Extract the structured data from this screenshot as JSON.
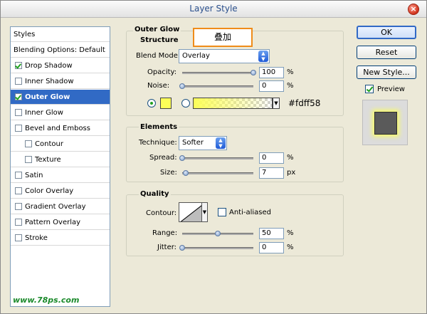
{
  "window": {
    "title": "Layer Style",
    "close_glyph": "×"
  },
  "callout_text": "叠加",
  "left_pane": {
    "items": [
      {
        "label": "Styles",
        "checkbox": false,
        "checked": false,
        "selected": false,
        "sub": false
      },
      {
        "label": "Blending Options: Default",
        "checkbox": false,
        "checked": false,
        "selected": false,
        "sub": false
      },
      {
        "label": "Drop Shadow",
        "checkbox": true,
        "checked": true,
        "selected": false,
        "sub": false
      },
      {
        "label": "Inner Shadow",
        "checkbox": true,
        "checked": false,
        "selected": false,
        "sub": false
      },
      {
        "label": "Outer Glow",
        "checkbox": true,
        "checked": true,
        "selected": true,
        "sub": false
      },
      {
        "label": "Inner Glow",
        "checkbox": true,
        "checked": false,
        "selected": false,
        "sub": false
      },
      {
        "label": "Bevel and Emboss",
        "checkbox": true,
        "checked": false,
        "selected": false,
        "sub": false
      },
      {
        "label": "Contour",
        "checkbox": true,
        "checked": false,
        "selected": false,
        "sub": true
      },
      {
        "label": "Texture",
        "checkbox": true,
        "checked": false,
        "selected": false,
        "sub": true
      },
      {
        "label": "Satin",
        "checkbox": true,
        "checked": false,
        "selected": false,
        "sub": false
      },
      {
        "label": "Color Overlay",
        "checkbox": true,
        "checked": false,
        "selected": false,
        "sub": false
      },
      {
        "label": "Gradient Overlay",
        "checkbox": true,
        "checked": false,
        "selected": false,
        "sub": false
      },
      {
        "label": "Pattern Overlay",
        "checkbox": true,
        "checked": false,
        "selected": false,
        "sub": false
      },
      {
        "label": "Stroke",
        "checkbox": true,
        "checked": false,
        "selected": false,
        "sub": false
      }
    ],
    "watermark": "www.78ps.com"
  },
  "outer_glow": {
    "section_title": "Outer Glow",
    "structure": {
      "title": "Structure",
      "blend_mode_label": "Blend Mode:",
      "blend_mode_value": "Overlay",
      "opacity_label": "Opacity:",
      "opacity_value": "100",
      "opacity_level": 1.0,
      "noise_label": "Noise:",
      "noise_value": "0",
      "noise_level": 0.0,
      "percent": "%",
      "glow_color": "#fdff58",
      "glow_color_label": "#fdff58",
      "solid_radio_selected": true
    },
    "elements": {
      "title": "Elements",
      "technique_label": "Technique:",
      "technique_value": "Softer",
      "spread_label": "Spread:",
      "spread_value": "0",
      "spread_level": 0.0,
      "size_label": "Size:",
      "size_value": "7",
      "size_level": 0.05,
      "percent": "%",
      "px": "px"
    },
    "quality": {
      "title": "Quality",
      "contour_label": "Contour:",
      "anti_aliased_label": "Anti-aliased",
      "anti_aliased_checked": false,
      "range_label": "Range:",
      "range_value": "50",
      "range_level": 0.5,
      "jitter_label": "Jitter:",
      "jitter_value": "0",
      "jitter_level": 0.0,
      "percent": "%"
    }
  },
  "buttons": {
    "ok": "OK",
    "reset": "Reset",
    "new_style": "New Style...",
    "preview_label": "Preview",
    "preview_checked": true
  },
  "colors": {
    "selected_row": "#316ac5",
    "glow": "#fdff58",
    "callout_border": "#ef8c1a"
  }
}
